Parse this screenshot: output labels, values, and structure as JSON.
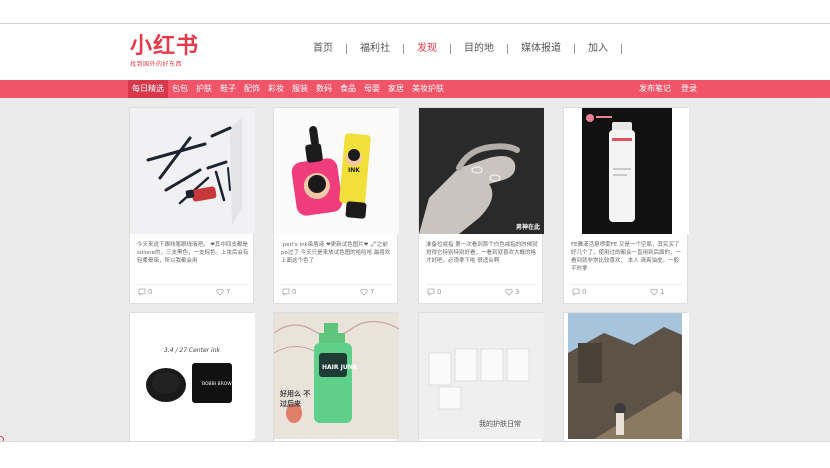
{
  "logo": {
    "main": "小红书",
    "sub": "找到国外的好东西"
  },
  "top_nav": [
    "首页",
    "福利社",
    "发现",
    "目的地",
    "媒体报道",
    "加入"
  ],
  "top_nav_active": 2,
  "categories": [
    "每日精选",
    "包包",
    "护肤",
    "鞋子",
    "配饰",
    "彩妆",
    "服装",
    "数码",
    "食品",
    "母婴",
    "家居",
    "美妆护肤"
  ],
  "categories_active": 0,
  "right_links": {
    "post": "发布笔记",
    "login": "登录"
  },
  "colors": {
    "brand": "#e8394a",
    "catbar": "#ef5468",
    "catbar_active": "#d8374c"
  },
  "cards": [
    {
      "desc": "今天来说下眼线笔眼线液吧。 ❤其中四支都是solone的，三支黑色，一支棕色。上妆后会有轻柔晕染，所以我都会用",
      "comments": "0",
      "likes": "7"
    },
    {
      "desc": ".peri's ink染唇液 ❤更新试色图片❤ 🖍之前po过了 今天只是来放试色图的哈哈哈 最喜欢上面这个色了",
      "comments": "0",
      "likes": "7"
    },
    {
      "desc": "准备拉戒指 第一次看到那个白色戒指的时候就觉得它特别特别好看，一看到就喜欢大概的格才好吧，必须拿下啦 很适合啊",
      "comments": "0",
      "likes": "3",
      "overlay": "男神在此"
    },
    {
      "desc": "FE雅漾活泉喷雾FE 又是一个空瓶，其实买了好几个了，使用过的都会一直用到后面的，一看到就非常比较喜欢， 本人 清爽油皮，一般平时拿",
      "comments": "0",
      "likes": "1"
    },
    {
      "handwriting": "3.4 / 27 Center ink",
      "brand_text": "BOBBI BROWN"
    },
    {
      "label": "HAIR JUNK",
      "handwriting": "好用么 不过后来"
    },
    {
      "handwriting": "我的护肤日常"
    },
    {}
  ]
}
